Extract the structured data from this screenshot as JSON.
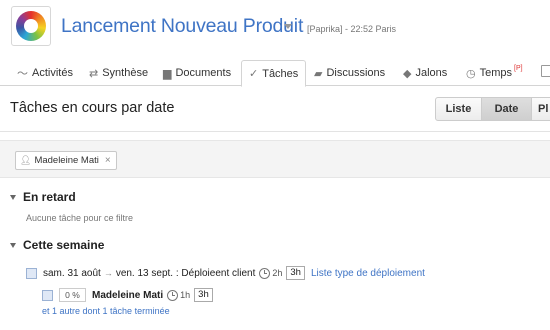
{
  "header": {
    "project_title": "Lancement Nouveau Produit",
    "meta": "[Paprika] - 22:52 Paris"
  },
  "tabs": [
    {
      "label": "Activités",
      "icon": "pulse-icon"
    },
    {
      "label": "Synthèse",
      "icon": "synthesis-icon"
    },
    {
      "label": "Documents",
      "icon": "folder-icon"
    },
    {
      "label": "Tâches",
      "icon": "checkmark-icon",
      "active": true
    },
    {
      "label": "Discussions",
      "icon": "chat-bubbles-icon"
    },
    {
      "label": "Jalons",
      "icon": "diamond-icon"
    },
    {
      "label": "Temps",
      "icon": "clock-icon",
      "badge": "[P]"
    }
  ],
  "page": {
    "title": "Tâches en cours par date",
    "views": {
      "liste": "Liste",
      "date": "Date",
      "planning": "Pl"
    },
    "active_view": "Date"
  },
  "filter": {
    "chip_label": "Madeleine Mati",
    "remove_glyph": "×"
  },
  "groups": {
    "late": {
      "title": "En retard",
      "empty_note": "Aucune tâche pour ce filtre"
    },
    "this_week": {
      "title": "Cette semaine"
    }
  },
  "task": {
    "start": "sam. 31 août",
    "arrow": "→",
    "end_and_title": "ven. 13 sept. : Déploieent client",
    "duration": "2h",
    "hours": "3h",
    "list_link": "Liste type de déploiement"
  },
  "subtask": {
    "percent": "0 %",
    "assignee": "Madeleine Mati",
    "duration": "1h",
    "hours": "3h"
  },
  "more_link": "et 1 autre dont 1 tâche terminée",
  "colors": {
    "accent": "#3f74c5",
    "badge": "#dd3333"
  }
}
